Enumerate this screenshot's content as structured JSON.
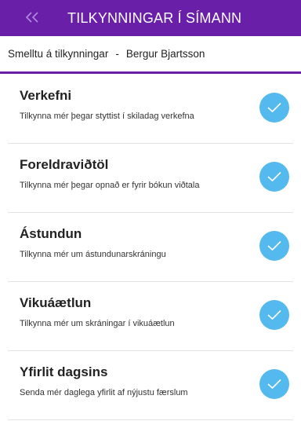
{
  "header": {
    "title": "TILKYNNINGAR Í SÍMANN",
    "back_icon": "double-chevron-left-icon",
    "background": "#6a1fa8"
  },
  "subheader": {
    "label": "Smelltu á tilkynningar",
    "separator": "-",
    "user": "Bergur Bjartsson"
  },
  "items": [
    {
      "title": "Verkefni",
      "description": "Tilkynna mér þegar styttist í skiladag verkefna",
      "checked": true
    },
    {
      "title": "Foreldraviðtöl",
      "description": "Tilkynna mér þegar opnað er fyrir bókun viðtala",
      "checked": true
    },
    {
      "title": "Ástundun",
      "description": "Tilkynna mér um ástundunarskráningu",
      "checked": true
    },
    {
      "title": "Vikuáætlun",
      "description": "Tilkynna mér um skráningar í vikuáætlun",
      "checked": true
    },
    {
      "title": "Yfirlit dagsins",
      "description": "Senda mér daglega yfirlit af nýjustu færslum",
      "checked": true
    }
  ],
  "colors": {
    "accent": "#6a1fa8",
    "check": "#53b9ee"
  }
}
